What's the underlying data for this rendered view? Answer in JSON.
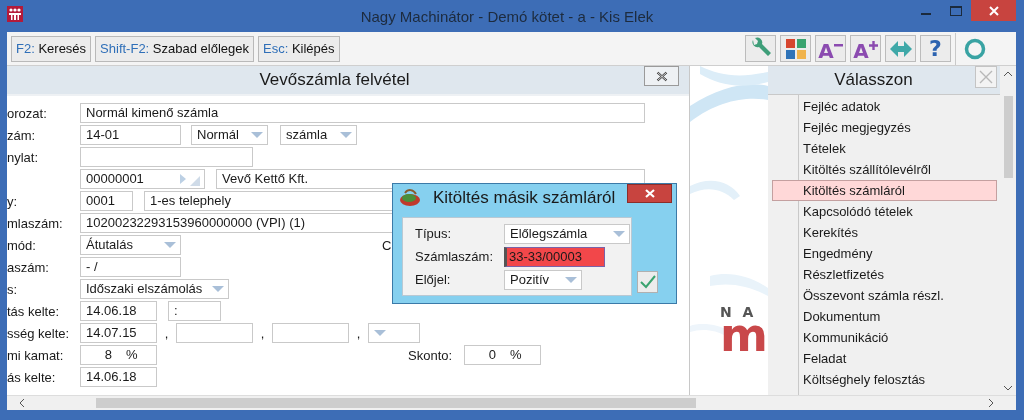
{
  "window": {
    "title": "Nagy Machinátor - Demó kötet - a - Kis Elek"
  },
  "toolbar": {
    "shortcuts": [
      {
        "key": "F2:",
        "label": "Keresés"
      },
      {
        "key": "Shift-F2:",
        "label": "Szabad előlegek"
      },
      {
        "key": "Esc:",
        "label": "Kilépés"
      }
    ],
    "tools": [
      {
        "kind": "wrench"
      },
      {
        "kind": "tiles"
      },
      {
        "kind": "font-smaller",
        "glyph": "A"
      },
      {
        "kind": "font-larger",
        "glyph": "A"
      },
      {
        "kind": "arrows"
      },
      {
        "kind": "help",
        "glyph": "?"
      },
      {
        "kind": "circle"
      }
    ]
  },
  "form": {
    "title": "Vevőszámla felvétel",
    "rows": [
      {
        "label": "orozat:",
        "items": [
          {
            "kind": "text",
            "value": "Normál kimenő számla"
          }
        ]
      },
      {
        "label": "zám:",
        "items": [
          {
            "kind": "text",
            "value": "14-01"
          },
          {
            "kind": "dropdown",
            "value": "Normál"
          },
          {
            "kind": "dropdown",
            "value": "számla"
          }
        ]
      },
      {
        "label": "nylat:",
        "items": [
          {
            "kind": "text"
          }
        ]
      },
      {
        "items": [
          {
            "kind": "lookup",
            "value": "00000001"
          },
          {
            "kind": "text",
            "value": "Vevő Kettő Kft."
          }
        ]
      },
      {
        "label": "y:",
        "items": [
          {
            "kind": "text",
            "value": "0001"
          },
          {
            "kind": "text",
            "value": "1-es telephely"
          }
        ]
      },
      {
        "label": "mlaszám:",
        "items": [
          {
            "kind": "text",
            "value": "10200232293153960000000 (VPI) (1)"
          }
        ]
      },
      {
        "label": "mód:",
        "items": [
          {
            "kind": "dropdown",
            "value": "Átutalás"
          },
          {
            "kind": "label",
            "value": "C"
          }
        ]
      },
      {
        "label": "aszám:",
        "items": [
          {
            "kind": "text",
            "value": "- /"
          }
        ]
      },
      {
        "label": "s:",
        "items": [
          {
            "kind": "dropdown",
            "value": "Időszaki elszámolás"
          }
        ]
      },
      {
        "label": "tás kelte:",
        "items": [
          {
            "kind": "text",
            "value": "14.06.18"
          },
          {
            "kind": "text",
            "value": ":"
          }
        ]
      },
      {
        "label": "sség kelte:",
        "items": [
          {
            "kind": "text",
            "value": "14.07.15"
          },
          {
            "kind": "sep",
            "value": ","
          },
          {
            "kind": "text"
          },
          {
            "kind": "sep",
            "value": ","
          },
          {
            "kind": "text"
          },
          {
            "kind": "sep",
            "value": ","
          },
          {
            "kind": "dropdown"
          }
        ]
      },
      {
        "label": "mi kamat:",
        "items": [
          {
            "kind": "percent",
            "value": "8",
            "unit": "%"
          },
          {
            "kind": "label",
            "value": "Skonto:"
          },
          {
            "kind": "percent",
            "value": "0",
            "unit": "%"
          }
        ]
      },
      {
        "label": "ás kelte:",
        "items": [
          {
            "kind": "text",
            "value": "14.06.18"
          }
        ]
      }
    ]
  },
  "logo": {
    "letters": "N A",
    "mark": "m"
  },
  "menu": {
    "title": "Válasszon",
    "items": [
      {
        "label": "Fejléc adatok",
        "selected": false
      },
      {
        "label": "Fejléc megjegyzés",
        "selected": false
      },
      {
        "label": "Tételek",
        "selected": false
      },
      {
        "label": "Kitöltés szállítólevélről",
        "selected": false
      },
      {
        "label": "Kitöltés számláról",
        "selected": true
      },
      {
        "label": "Kapcsolódó tételek",
        "selected": false
      },
      {
        "label": "Kerekítés",
        "selected": false
      },
      {
        "label": "Engedmény",
        "selected": false
      },
      {
        "label": "Részletfizetés",
        "selected": false
      },
      {
        "label": "Összevont számla részl.",
        "selected": false
      },
      {
        "label": "Dokumentum",
        "selected": false
      },
      {
        "label": "Kommunikáció",
        "selected": false
      },
      {
        "label": "Feladat",
        "selected": false
      },
      {
        "label": "Költséghely felosztás",
        "selected": false
      }
    ]
  },
  "dialog": {
    "title": "Kitöltés másik számláról",
    "fields": [
      {
        "label": "Típus:",
        "kind": "dropdown",
        "value": "Előlegszámla"
      },
      {
        "label": "Számlaszám:",
        "kind": "invalid",
        "value": "33-33/00003"
      },
      {
        "label": "Előjel:",
        "kind": "dropdown",
        "value": "Pozitív"
      }
    ]
  }
}
